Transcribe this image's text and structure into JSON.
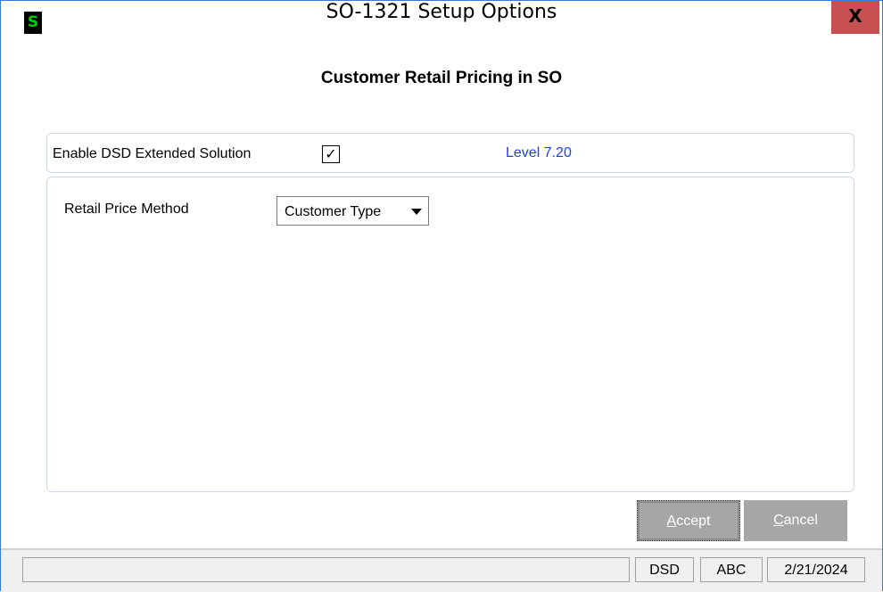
{
  "window": {
    "title": "SO-1321 Setup Options",
    "app_icon_glyph": "S",
    "close_glyph": "X"
  },
  "heading": "Customer Retail Pricing in SO",
  "enable": {
    "label": "Enable DSD Extended Solution",
    "checked": true,
    "check_glyph": "✓",
    "level": "Level  7.20"
  },
  "retail": {
    "label": "Retail Price Method",
    "selected": "Customer Type"
  },
  "buttons": {
    "accept_underline": "A",
    "accept_rest": "ccept",
    "cancel_underline": "C",
    "cancel_rest": "ancel"
  },
  "status": {
    "message": "",
    "company_code": "DSD",
    "company": "ABC",
    "date": "2/21/2024"
  },
  "colors": {
    "accent_blue": "#1a3cff",
    "close_red": "#c75050",
    "button_gray": "#a6a6a6"
  }
}
